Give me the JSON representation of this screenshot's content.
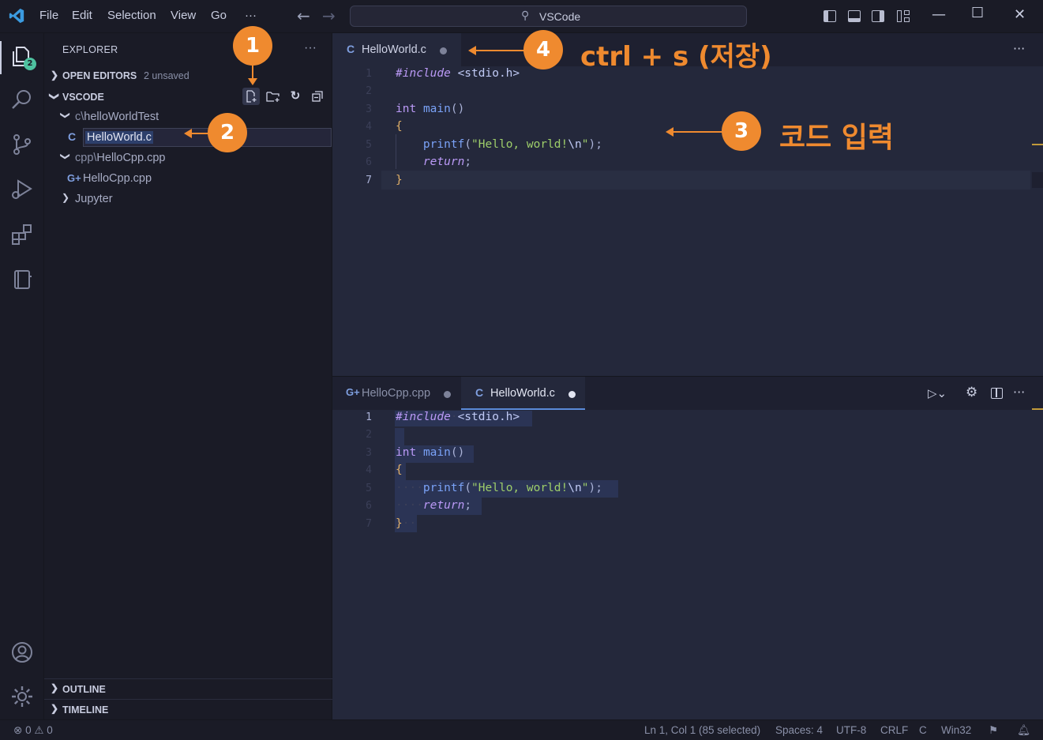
{
  "titlebar": {
    "menus": [
      "File",
      "Edit",
      "Selection",
      "View",
      "Go",
      "···"
    ],
    "command_center": "VSCode"
  },
  "activitybar": {
    "explorer_badge": "2"
  },
  "sidebar": {
    "title": "EXPLORER",
    "more": "···",
    "open_editors": {
      "label": "OPEN EDITORS",
      "sub": "2 unsaved"
    },
    "workspace": {
      "label": "VSCODE"
    },
    "tree": {
      "folder1_prefix": "c",
      "folder1_sep": "\\",
      "folder1_name": "helloWorldTest",
      "rename_value": "HelloWorld.c",
      "folder2_prefix": "cpp",
      "folder2_sep": "\\",
      "folder2_name": "HelloCpp.cpp",
      "file_cpp": "HelloCpp.cpp",
      "folder3": "Jupyter"
    },
    "outline": "OUTLINE",
    "timeline": "TIMELINE"
  },
  "editor_top": {
    "tab_label": "HelloWorld.c",
    "lines": [
      "1",
      "2",
      "3",
      "4",
      "5",
      "6",
      "7"
    ],
    "code": {
      "include_kw": "#include",
      "include_hdr": "<stdio.h>",
      "int_kw": "int",
      "main_fn": "main",
      "parens": "()",
      "open_brace": "{",
      "printf_fn": "printf",
      "str_part1": "\"Hello, world!",
      "str_esc": "\\n",
      "str_end": "\"",
      "tail": ");",
      "return_kw": "return",
      "semi": ";",
      "close_brace": "}"
    }
  },
  "editor_bottom": {
    "tab1_label": "HelloCpp.cpp",
    "tab2_label": "HelloWorld.c",
    "lines": [
      "1",
      "2",
      "3",
      "4",
      "5",
      "6",
      "7"
    ]
  },
  "statusbar": {
    "errors": "0",
    "warnings": "0",
    "position": "Ln 1, Col 1 (85 selected)",
    "spaces": "Spaces: 4",
    "encoding": "UTF-8",
    "eol": "CRLF",
    "language": "C",
    "platform": "Win32"
  },
  "annotations": {
    "step1": "1",
    "step2": "2",
    "step3": "3",
    "step4": "4",
    "step3_text": "코드 입력",
    "step4_text": "ctrl + s (저장)"
  },
  "colors": {
    "accent": "#ef8a2f",
    "background": "#24283b"
  }
}
